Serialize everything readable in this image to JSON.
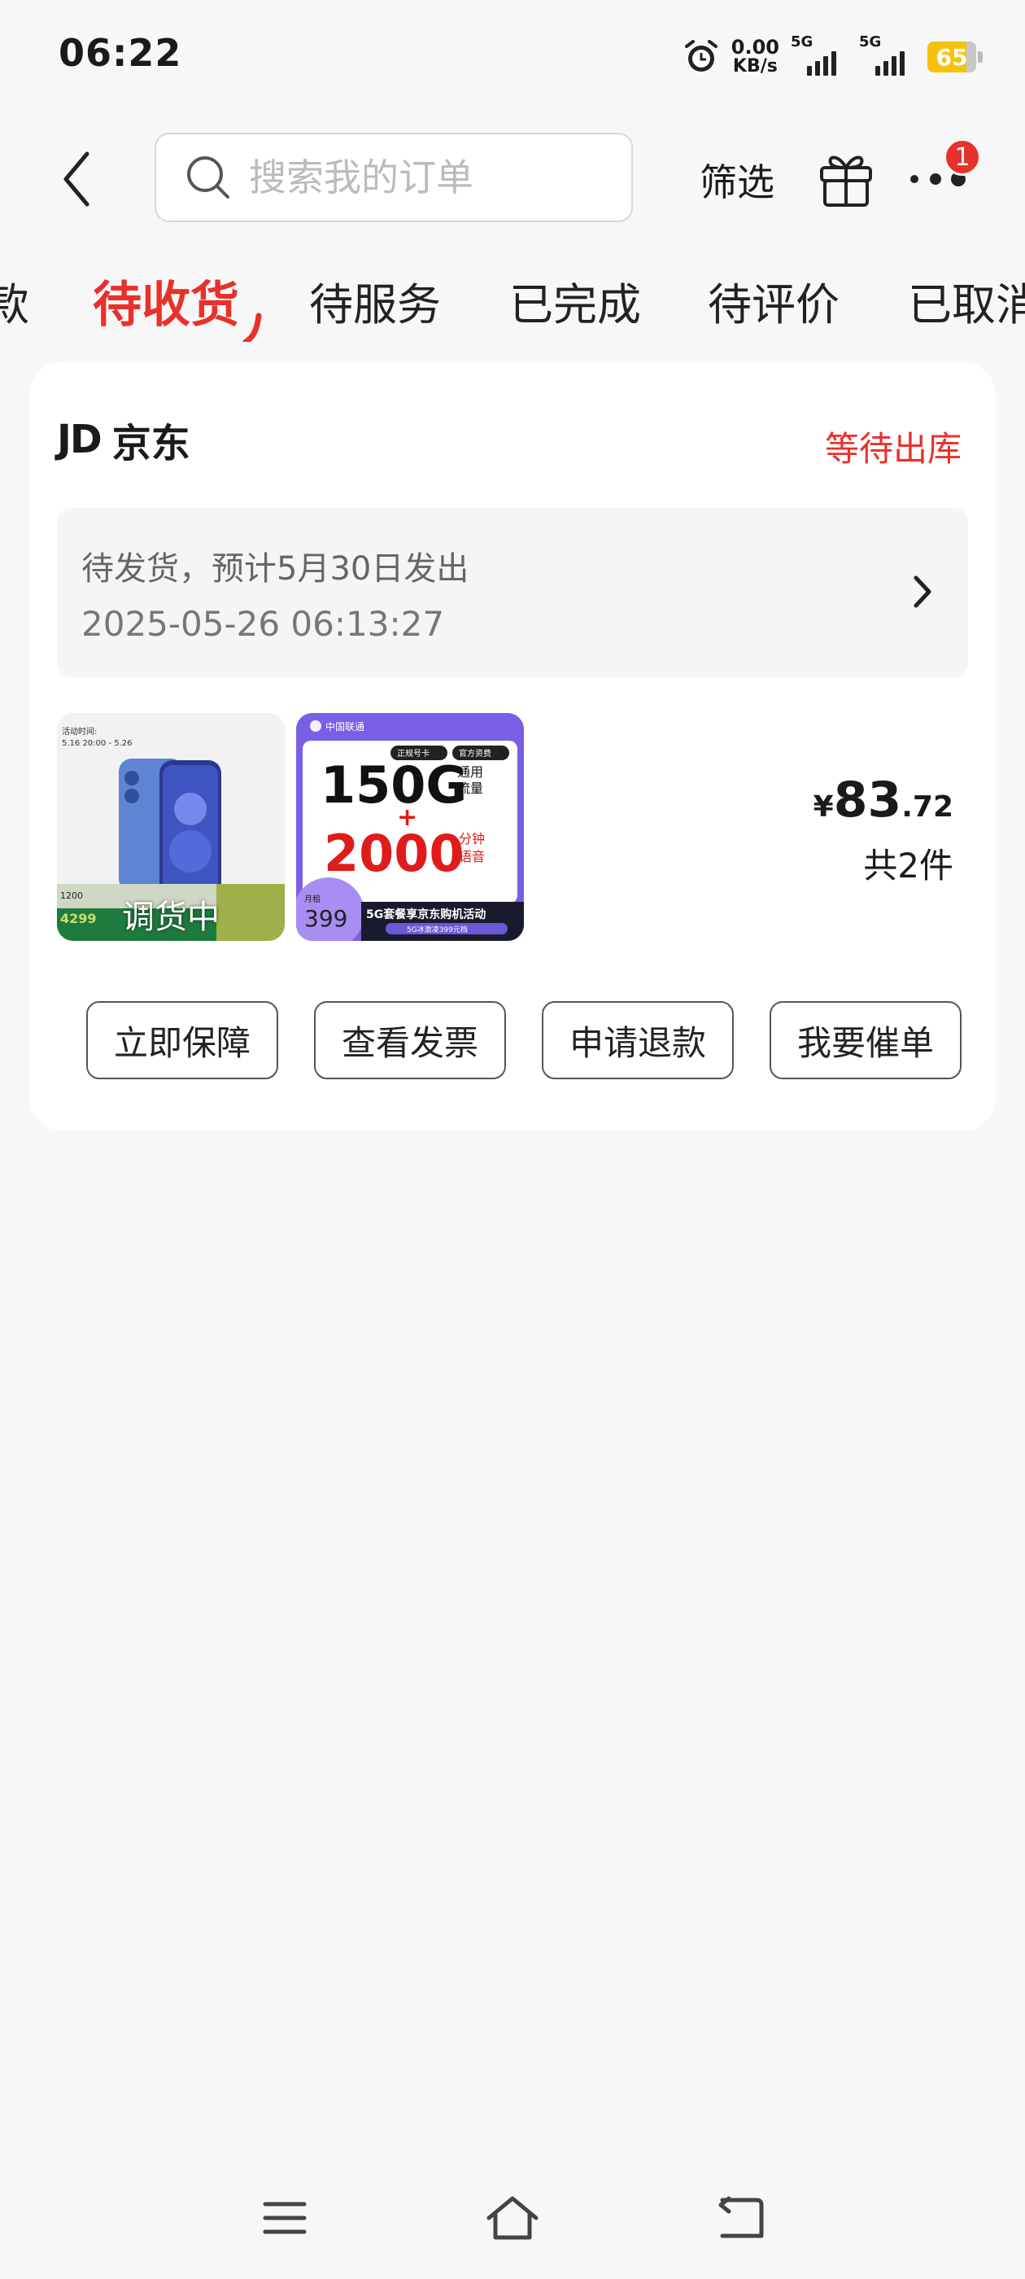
{
  "status_bar": {
    "time": "06:22",
    "net_speed_value": "0.00",
    "net_speed_unit": "KB/s",
    "signal1_label": "5G",
    "signal2_label": "5G",
    "battery": "65"
  },
  "header": {
    "search_placeholder": "搜索我的订单",
    "filter_label": "筛选",
    "more_badge": "1"
  },
  "tabs": [
    {
      "label": "款"
    },
    {
      "label": "待收货"
    },
    {
      "label": "待服务"
    },
    {
      "label": "已完成"
    },
    {
      "label": "待评价"
    },
    {
      "label": "已取消"
    }
  ],
  "order": {
    "shop_logo_text": "JD",
    "shop_name": "京东",
    "status": "等待出库",
    "ship_info": "待发货，预计5月30日发出",
    "order_time": "2025-05-26 06:13:27",
    "price_currency": "¥",
    "price_main": "83",
    "price_decimal": ".72",
    "quantity": "共2件",
    "item1_overlay": "调货中",
    "item1_promo_date": "5.16 20:00 - 5.26",
    "item1_price": "4299",
    "item2": {
      "brand": "中国联通",
      "tag1": "正规号卡",
      "tag2": "官方资费",
      "data": "150G",
      "data_unit": "通用流量",
      "plus": "+",
      "minutes": "2000",
      "minutes_unit": "分钟语音",
      "monthly_label": "月租",
      "monthly_price": "399",
      "banner": "5G套餐享京东购机活动",
      "sub_banner": "5G冰激凌399元档"
    },
    "actions": [
      {
        "label": "立即保障"
      },
      {
        "label": "查看发票"
      },
      {
        "label": "申请退款"
      },
      {
        "label": "我要催单"
      }
    ]
  },
  "colors": {
    "accent": "#e8312b",
    "battery": "#f4c20d",
    "card_bg": "#ffffff",
    "page_bg": "#f7f7f7"
  },
  "icons": [
    "back-icon",
    "search-icon",
    "gift-icon",
    "more-icon",
    "chevron-right-icon",
    "menu-icon",
    "home-icon",
    "return-icon",
    "alarm-icon"
  ]
}
